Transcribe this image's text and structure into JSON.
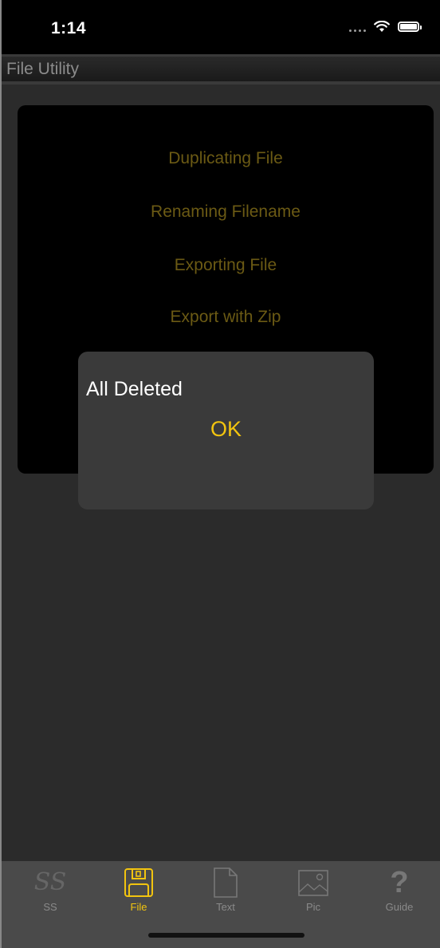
{
  "status_bar": {
    "time": "1:14"
  },
  "nav": {
    "title": "File Utility"
  },
  "menu": {
    "items": [
      {
        "label": "Duplicating File"
      },
      {
        "label": "Renaming Filename"
      },
      {
        "label": "Exporting File"
      },
      {
        "label": "Export with Zip"
      }
    ]
  },
  "alert": {
    "title": "All Deleted",
    "ok_label": "OK"
  },
  "tabs": [
    {
      "label": "SS",
      "icon": "ss-logo-icon"
    },
    {
      "label": "File",
      "icon": "floppy-disk-icon",
      "active": true
    },
    {
      "label": "Text",
      "icon": "document-icon"
    },
    {
      "label": "Pic",
      "icon": "picture-icon"
    },
    {
      "label": "Guide",
      "icon": "question-mark-icon"
    }
  ],
  "colors": {
    "accent": "#f2c40f",
    "menu_text": "#6b5a14",
    "content_bg": "#2b2b2b",
    "tab_bar_bg": "#4a4a4a",
    "alert_bg": "#3a3a3a"
  }
}
